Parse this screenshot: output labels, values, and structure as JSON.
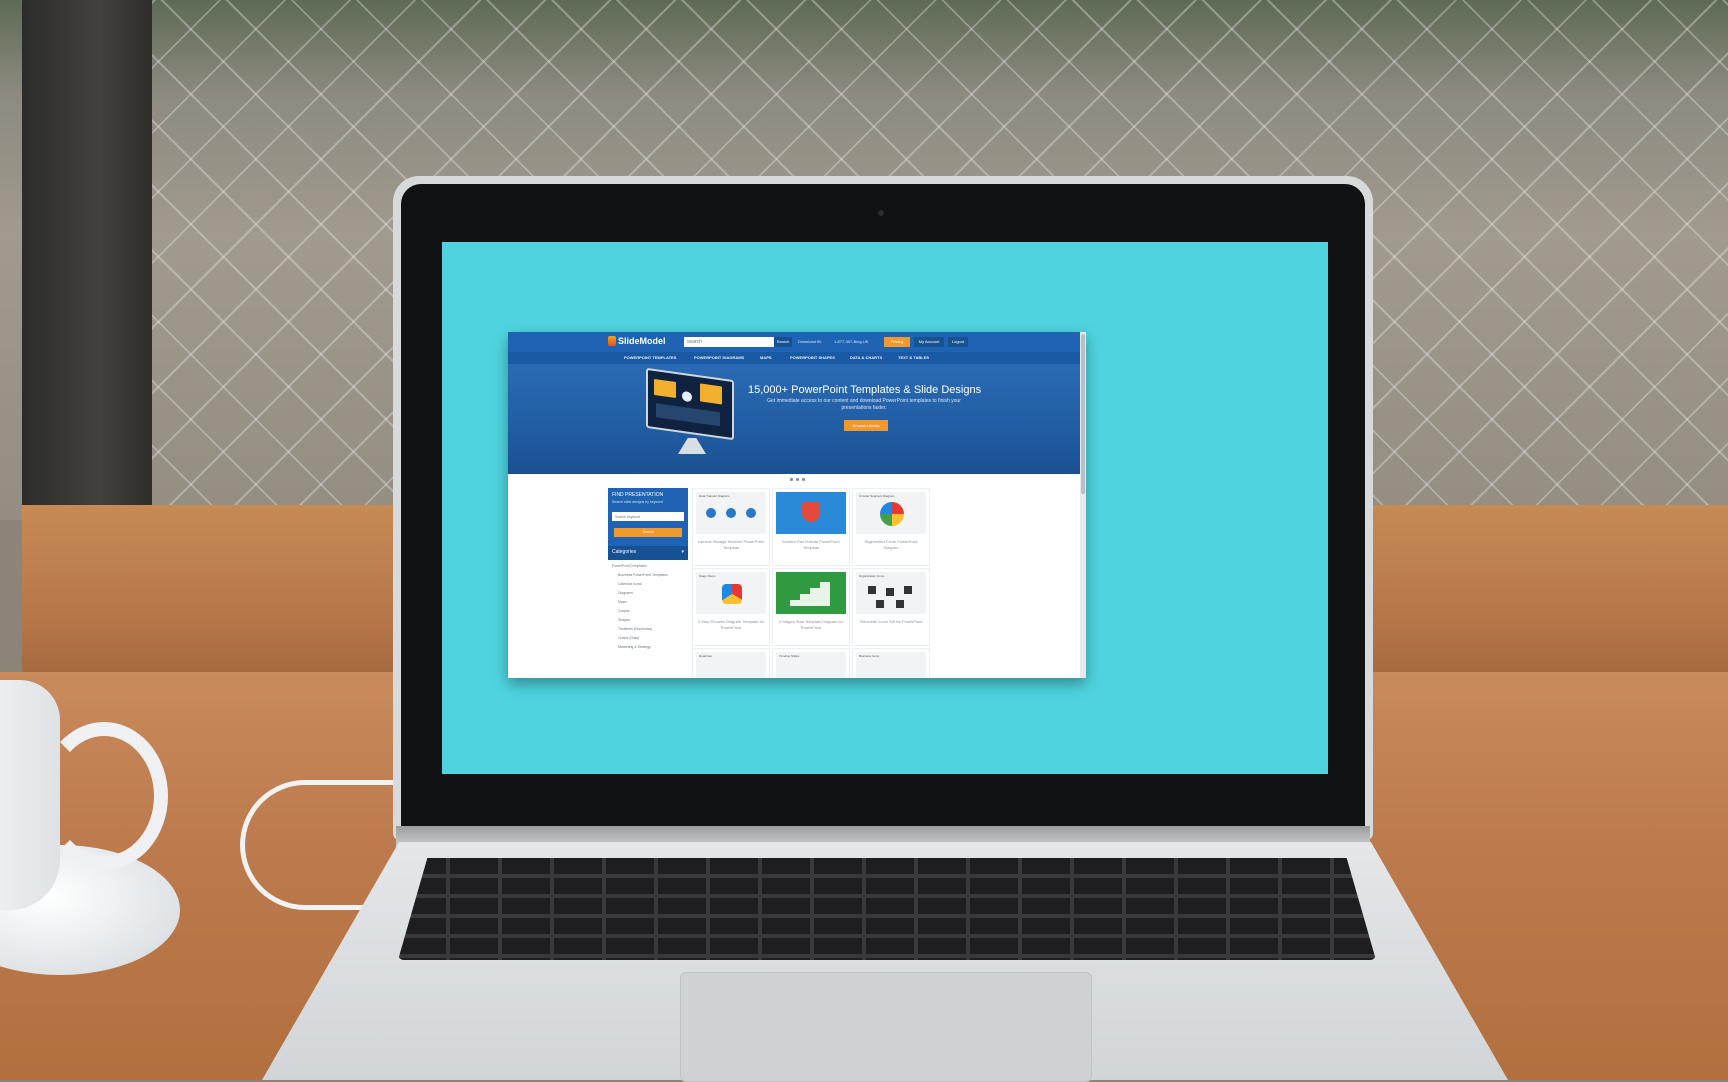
{
  "site": {
    "logo": "SlideModel",
    "search_placeholder": "search",
    "search_button": "Search",
    "top_links": [
      "Download 50",
      "1-877-357-Bing-UK"
    ],
    "pricing_button": "Pricing",
    "account_button": "My Account",
    "logout_button": "Logout",
    "nav": [
      "POWERPOINT TEMPLATES",
      "POWERPOINT DIAGRAMS",
      "MAPS",
      "POWERPOINT SHAPES",
      "DATA & CHARTS",
      "TEXT & TABLES"
    ],
    "hero": {
      "title": "15,000+ PowerPoint Templates & Slide Designs",
      "subtitle": "Get immediate access to our content and download PowerPoint templates to finish your presentations faster.",
      "cta": "Browse Library"
    },
    "find": {
      "title": "FIND PRESENTATION",
      "subtitle": "Search slide designs by keyword",
      "input_placeholder": "Search keyword",
      "button": "Search",
      "categories_label": "Categories"
    },
    "categories": [
      {
        "label": "PowerPoint Templates",
        "sub": false
      },
      {
        "label": "Business PowerPoint Templates",
        "sub": true
      },
      {
        "label": "Calendar Icons",
        "sub": true
      },
      {
        "label": "Diagrams",
        "sub": true
      },
      {
        "label": "Maps",
        "sub": true
      },
      {
        "label": "Graphs",
        "sub": true
      },
      {
        "label": "Shapes",
        "sub": true
      },
      {
        "label": "Timelines (Horizontal)",
        "sub": true
      },
      {
        "label": "Charts (Data)",
        "sub": true
      },
      {
        "label": "Marketing & Strategy",
        "sub": true
      }
    ],
    "cards": [
      {
        "caption": "Data Transfer Diagram",
        "title": "Internal Storage Network PowerPoint Template"
      },
      {
        "caption": "",
        "title": "Modern Flat Shields PowerPoint Template"
      },
      {
        "caption": "Circular Segment Diagram",
        "title": "Segmented Circle PowerPoint Diagram"
      },
      {
        "caption": "Stage Steps",
        "title": "3 Step Process Diagram Template for PowerPoint"
      },
      {
        "caption": "",
        "title": "4 Stages Stair Template Diagram for PowerPoint"
      },
      {
        "caption": "Organization Icons",
        "title": "Silhouette Icons Set for PowerPoint"
      },
      {
        "caption": "Roadmap",
        "title": ""
      },
      {
        "caption": "Timeline Slides",
        "title": ""
      },
      {
        "caption": "Business Icons",
        "title": ""
      }
    ]
  },
  "colors": {
    "screen_bg": "#4fd4df",
    "site_blue": "#1e63b4",
    "accent_orange": "#f2992e"
  }
}
